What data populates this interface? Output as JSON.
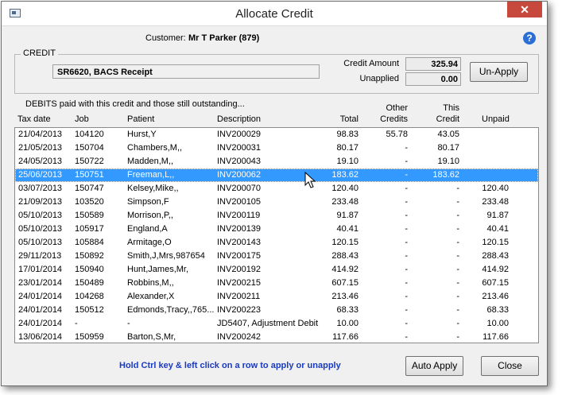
{
  "window": {
    "title": "Allocate Credit",
    "close_label": "✕"
  },
  "customer": {
    "label": "Customer:",
    "value": "Mr T Parker (879)"
  },
  "help_label": "?",
  "credit": {
    "legend": "CREDIT",
    "reference": "SR6620, BACS Receipt",
    "amount_label": "Credit Amount",
    "amount": "325.94",
    "unapplied_label": "Unapplied",
    "unapplied": "0.00",
    "unapply_button": "Un-Apply"
  },
  "debits_label": "DEBITS paid with this credit and those still outstanding...",
  "columns": {
    "tax_date": "Tax date",
    "job": "Job",
    "patient": "Patient",
    "description": "Description",
    "total": "Total",
    "other_credits_1": "Other",
    "other_credits_2": "Credits",
    "this_credit_1": "This",
    "this_credit_2": "Credit",
    "unpaid": "Unpaid"
  },
  "rows": [
    {
      "date": "21/04/2013",
      "job": "104120",
      "patient": "Hurst,Y",
      "desc": "INV200029",
      "total": "98.83",
      "other": "55.78",
      "this": "43.05",
      "unpaid": ""
    },
    {
      "date": "21/05/2013",
      "job": "150704",
      "patient": "Chambers,M,,",
      "desc": "INV200031",
      "total": "80.17",
      "other": "-",
      "this": "80.17",
      "unpaid": ""
    },
    {
      "date": "24/05/2013",
      "job": "150722",
      "patient": "Madden,M,,",
      "desc": "INV200043",
      "total": "19.10",
      "other": "-",
      "this": "19.10",
      "unpaid": ""
    },
    {
      "date": "25/06/2013",
      "job": "150751",
      "patient": "Freeman,L,,",
      "desc": "INV200062",
      "total": "183.62",
      "other": "-",
      "this": "183.62",
      "unpaid": ""
    },
    {
      "date": "03/07/2013",
      "job": "150747",
      "patient": "Kelsey,Mike,,",
      "desc": "INV200070",
      "total": "120.40",
      "other": "-",
      "this": "-",
      "unpaid": "120.40"
    },
    {
      "date": "21/09/2013",
      "job": "103520",
      "patient": "Simpson,F",
      "desc": "INV200105",
      "total": "233.48",
      "other": "-",
      "this": "-",
      "unpaid": "233.48"
    },
    {
      "date": "05/10/2013",
      "job": "150589",
      "patient": "Morrison,P,,",
      "desc": "INV200119",
      "total": "91.87",
      "other": "-",
      "this": "-",
      "unpaid": "91.87"
    },
    {
      "date": "05/10/2013",
      "job": "105917",
      "patient": "England,A",
      "desc": "INV200139",
      "total": "40.41",
      "other": "-",
      "this": "-",
      "unpaid": "40.41"
    },
    {
      "date": "05/10/2013",
      "job": "105884",
      "patient": "Armitage,O",
      "desc": "INV200143",
      "total": "120.15",
      "other": "-",
      "this": "-",
      "unpaid": "120.15"
    },
    {
      "date": "29/11/2013",
      "job": "150892",
      "patient": "Smith,J,Mrs,987654",
      "desc": "INV200175",
      "total": "288.43",
      "other": "-",
      "this": "-",
      "unpaid": "288.43"
    },
    {
      "date": "17/01/2014",
      "job": "150940",
      "patient": "Hunt,James,Mr,",
      "desc": "INV200192",
      "total": "414.92",
      "other": "-",
      "this": "-",
      "unpaid": "414.92"
    },
    {
      "date": "23/01/2014",
      "job": "150489",
      "patient": "Robbins,M,,",
      "desc": "INV200215",
      "total": "607.15",
      "other": "-",
      "this": "-",
      "unpaid": "607.15"
    },
    {
      "date": "24/01/2014",
      "job": "104268",
      "patient": "Alexander,X",
      "desc": "INV200211",
      "total": "213.46",
      "other": "-",
      "this": "-",
      "unpaid": "213.46"
    },
    {
      "date": "24/01/2014",
      "job": "150512",
      "patient": "Edmonds,Tracy,,765...",
      "desc": "INV200223",
      "total": "68.33",
      "other": "-",
      "this": "-",
      "unpaid": "68.33"
    },
    {
      "date": "24/01/2014",
      "job": "-",
      "patient": "-",
      "desc": "JD5407, Adjustment Debit",
      "total": "10.00",
      "other": "-",
      "this": "-",
      "unpaid": "10.00"
    },
    {
      "date": "13/06/2014",
      "job": "150959",
      "patient": "Barton,S,Mr,",
      "desc": "INV200242",
      "total": "117.66",
      "other": "-",
      "this": "-",
      "unpaid": "117.66"
    }
  ],
  "selected_row_index": 3,
  "hint": "Hold Ctrl key & left click on a row to apply or unapply",
  "auto_apply_button": "Auto Apply",
  "close_button": "Close"
}
